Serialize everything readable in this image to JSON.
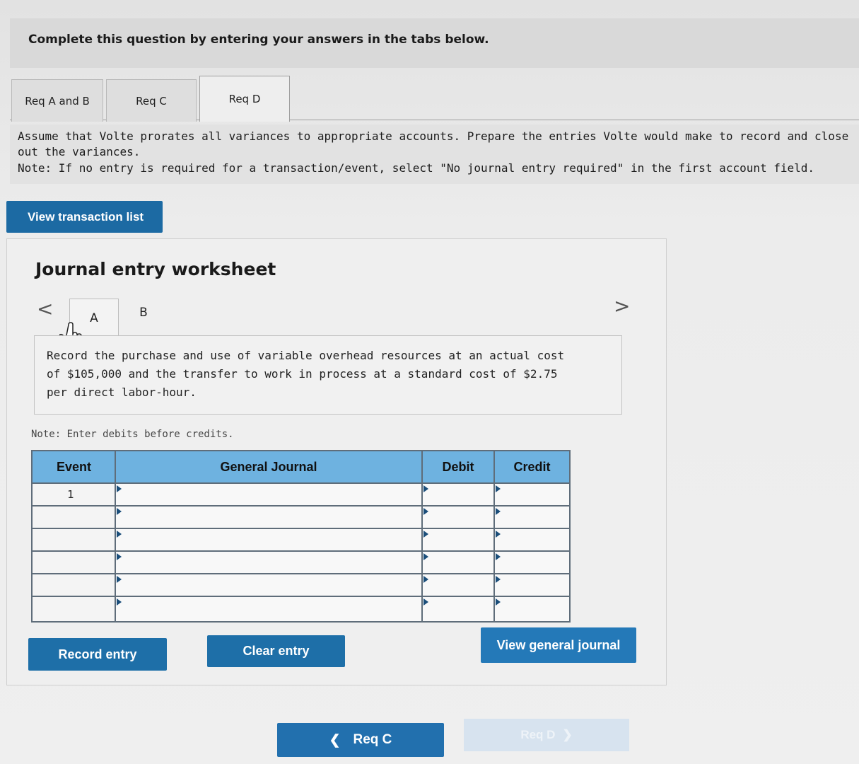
{
  "banner": {
    "text": "Complete this question by entering your answers in the tabs below."
  },
  "tabs": [
    {
      "label": "Req A and B"
    },
    {
      "label": "Req C"
    },
    {
      "label": "Req D"
    }
  ],
  "instructions": {
    "text": "Assume that Volte prorates all variances to appropriate accounts. Prepare the entries Volte would make to record and close out the variances.",
    "note": "Note: If no entry is required for a transaction/event, select \"No journal entry required\" in the first account field."
  },
  "view_transaction_list": "View transaction list",
  "worksheet": {
    "title": "Journal entry worksheet",
    "nav_prev": "<",
    "nav_next": ">",
    "subtabs": [
      {
        "label": "A"
      },
      {
        "label": "B"
      }
    ],
    "description": "Record the purchase and use of variable overhead resources at an actual cost of $105,000 and the transfer to work in process at a standard cost of $2.75 per direct labor-hour.",
    "debits_note": "Note: Enter debits before credits."
  },
  "journal": {
    "headers": {
      "event": "Event",
      "general_journal": "General Journal",
      "debit": "Debit",
      "credit": "Credit"
    },
    "rows": [
      {
        "event": "1",
        "account": "",
        "debit": "",
        "credit": ""
      },
      {
        "event": "",
        "account": "",
        "debit": "",
        "credit": ""
      },
      {
        "event": "",
        "account": "",
        "debit": "",
        "credit": ""
      },
      {
        "event": "",
        "account": "",
        "debit": "",
        "credit": ""
      },
      {
        "event": "",
        "account": "",
        "debit": "",
        "credit": ""
      },
      {
        "event": "",
        "account": "",
        "debit": "",
        "credit": ""
      }
    ]
  },
  "buttons": {
    "record_entry": "Record entry",
    "clear_entry": "Clear entry",
    "view_general_journal": "View general journal",
    "prev_label": "Req C",
    "next_label": "Req D"
  },
  "colors": {
    "primary_button": "#1e6fa8",
    "header_blue": "#6eb2e0"
  }
}
